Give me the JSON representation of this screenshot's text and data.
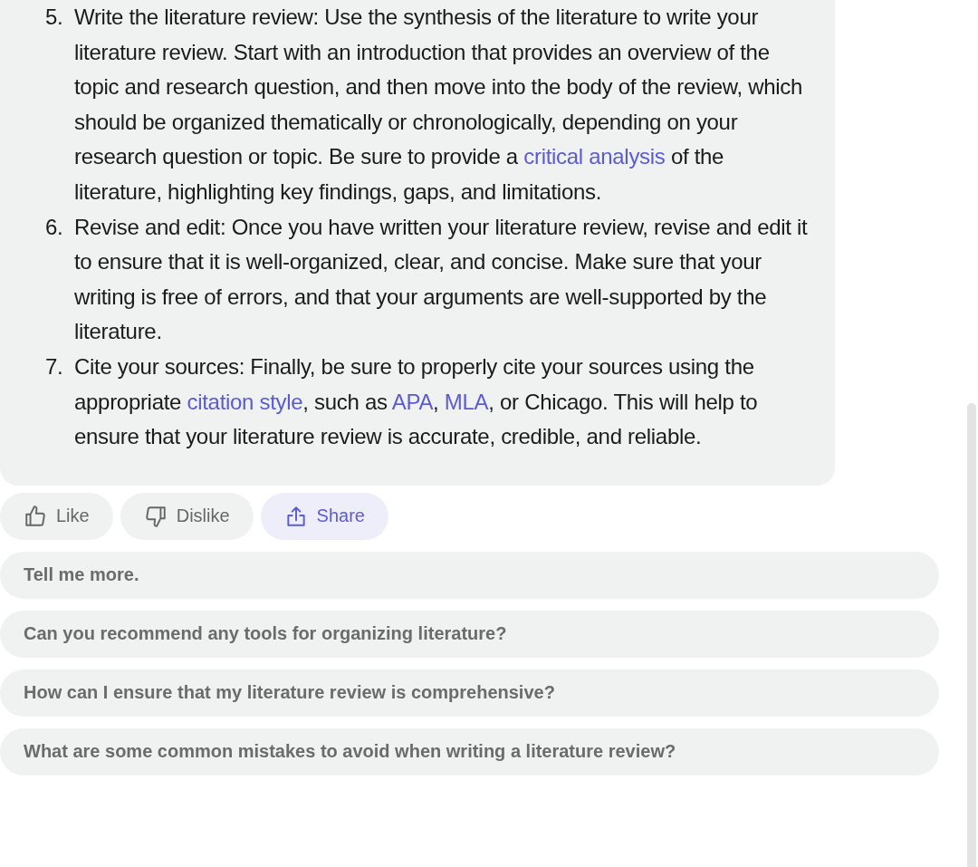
{
  "steps": [
    {
      "number": "5.",
      "parts": [
        {
          "kind": "text",
          "text": "Write the literature review: Use the synthesis of the literature to write your literature review. Start with an introduction that provides an overview of the topic and research question, and then move into the body of the review, which should be organized thematically or chronologically, depending on your research question or topic. Be sure to provide a "
        },
        {
          "kind": "link",
          "text": "critical analysis"
        },
        {
          "kind": "text",
          "text": " of the literature, highlighting key findings, gaps, and limitations."
        }
      ]
    },
    {
      "number": "6.",
      "parts": [
        {
          "kind": "text",
          "text": "Revise and edit: Once you have written your literature review, revise and edit it to ensure that it is well-organized, clear, and concise. Make sure that your writing is free of errors, and that your arguments are well-supported by the literature."
        }
      ]
    },
    {
      "number": "7.",
      "parts": [
        {
          "kind": "text",
          "text": "Cite your sources: Finally, be sure to properly cite your sources using the appropriate "
        },
        {
          "kind": "link",
          "text": "citation style"
        },
        {
          "kind": "text",
          "text": ", such as "
        },
        {
          "kind": "link",
          "text": "APA"
        },
        {
          "kind": "text",
          "text": ", "
        },
        {
          "kind": "link",
          "text": "MLA"
        },
        {
          "kind": "text",
          "text": ", or Chicago. This will help to ensure that your literature review is accurate, credible, and reliable."
        }
      ]
    }
  ],
  "actions": [
    {
      "kind": "like",
      "label": "Like",
      "selected": false
    },
    {
      "kind": "dislike",
      "label": "Dislike",
      "selected": false
    },
    {
      "kind": "share",
      "label": "Share",
      "selected": true
    }
  ],
  "suggestions": [
    "Tell me more.",
    "Can you recommend any tools for organizing literature?",
    "How can I ensure that my literature review is comprehensive?",
    "What are some common mistakes to avoid when writing a literature review?"
  ]
}
